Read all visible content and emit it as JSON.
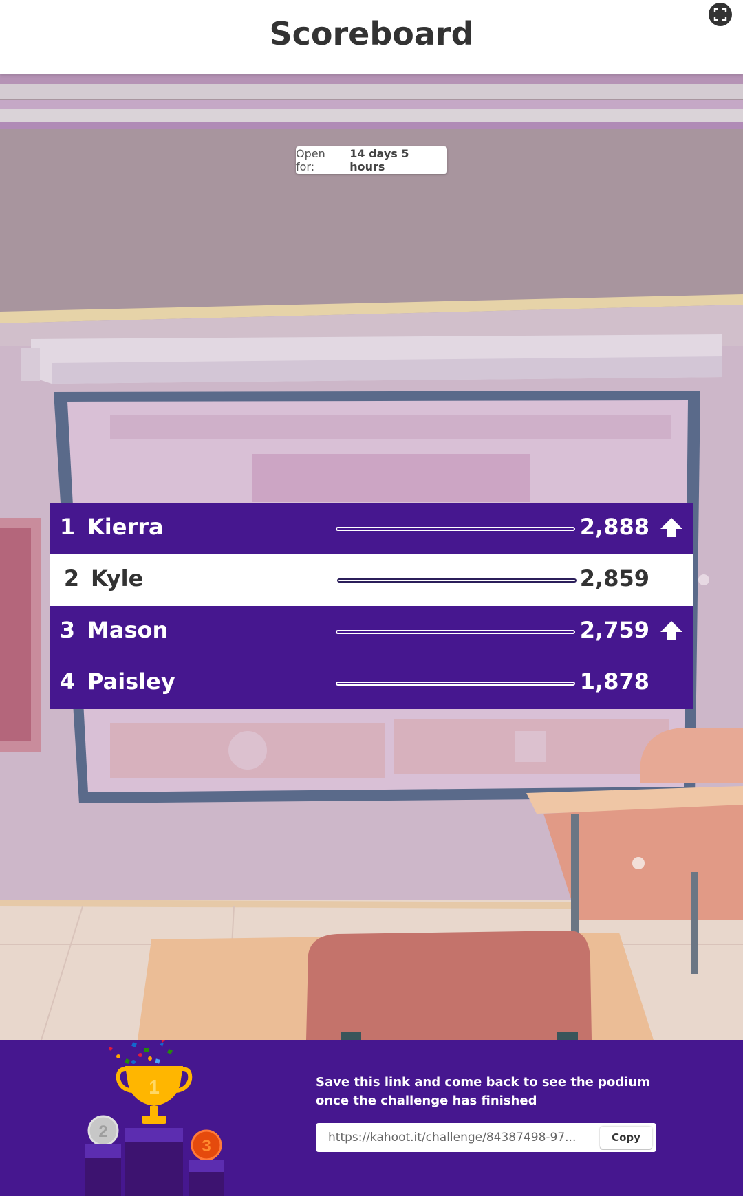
{
  "header": {
    "title": "Scoreboard",
    "fullscreen_icon": "fullscreen-icon"
  },
  "badge": {
    "label": "Open for:",
    "value": "14 days 5 hours"
  },
  "players": [
    {
      "rank": "1",
      "name": "Kierra",
      "score": "2,888",
      "trend": "up",
      "highlight": false
    },
    {
      "rank": "2",
      "name": "Kyle",
      "score": "2,859",
      "trend": "none",
      "highlight": true
    },
    {
      "rank": "3",
      "name": "Mason",
      "score": "2,759",
      "trend": "up",
      "highlight": false
    },
    {
      "rank": "4",
      "name": "Paisley",
      "score": "1,878",
      "trend": "none",
      "highlight": false
    }
  ],
  "footer": {
    "save_text": "Save this link and come back to see the podium once the challenge has finished",
    "link": "https://kahoot.it/challenge/84387498-97...",
    "copy_label": "Copy",
    "podium_labels": [
      "1",
      "2",
      "3"
    ]
  },
  "colors": {
    "primary": "#46178f",
    "highlight_row": "#ffffff",
    "title_text": "#333333"
  }
}
